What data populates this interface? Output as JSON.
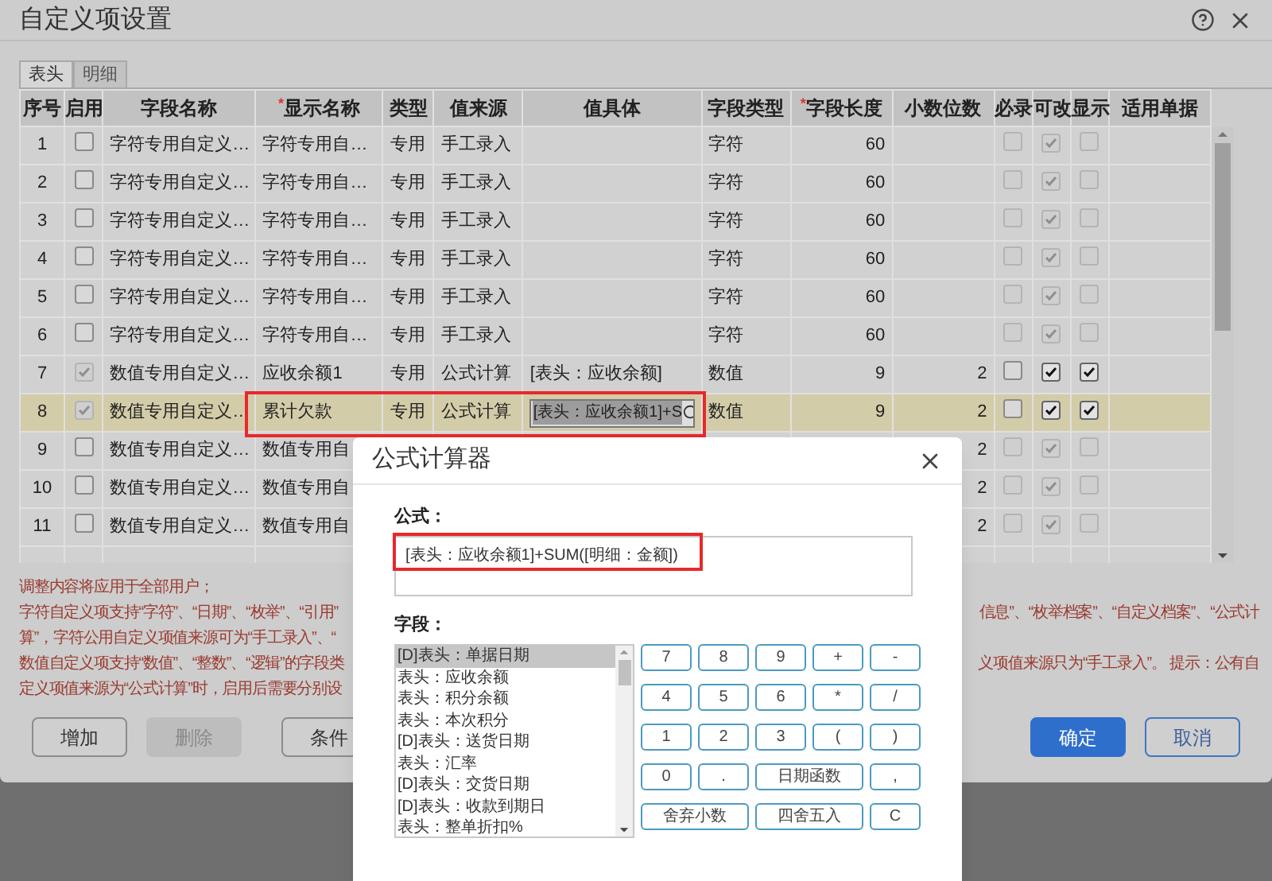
{
  "window": {
    "title": "自定义项设置"
  },
  "tabs": [
    {
      "label": "表头",
      "selected": true
    },
    {
      "label": "明细",
      "selected": false
    }
  ],
  "table": {
    "columns": [
      {
        "label": "序号",
        "required": false
      },
      {
        "label": "启用",
        "required": false
      },
      {
        "label": "字段名称",
        "required": false
      },
      {
        "label": "显示名称",
        "required": true
      },
      {
        "label": "类型",
        "required": false
      },
      {
        "label": "值来源",
        "required": false
      },
      {
        "label": "值具体",
        "required": false
      },
      {
        "label": "字段类型",
        "required": false
      },
      {
        "label": "字段长度",
        "required": true
      },
      {
        "label": "小数位数",
        "required": false
      },
      {
        "label": "必录",
        "required": false
      },
      {
        "label": "可改",
        "required": false
      },
      {
        "label": "显示",
        "required": false
      },
      {
        "label": "适用单据",
        "required": false
      }
    ],
    "rows": [
      {
        "seq": "1",
        "enabled": {
          "checked": false,
          "disabled": false
        },
        "name": "字符专用自定义…",
        "display": "字符专用自…",
        "type": "专用",
        "source": "手工录入",
        "field_type": "字符",
        "length": "60",
        "required": {
          "checked": false,
          "disabled": true
        },
        "editable": {
          "checked": true,
          "disabled": true
        },
        "shown": {
          "checked": false,
          "disabled": true
        },
        "selected": false,
        "marked": false
      },
      {
        "seq": "2",
        "enabled": {
          "checked": false,
          "disabled": false
        },
        "name": "字符专用自定义…",
        "display": "字符专用自…",
        "type": "专用",
        "source": "手工录入",
        "field_type": "字符",
        "length": "60",
        "required": {
          "checked": false,
          "disabled": true
        },
        "editable": {
          "checked": true,
          "disabled": true
        },
        "shown": {
          "checked": false,
          "disabled": true
        },
        "selected": false,
        "marked": false
      },
      {
        "seq": "3",
        "enabled": {
          "checked": false,
          "disabled": false
        },
        "name": "字符专用自定义…",
        "display": "字符专用自…",
        "type": "专用",
        "source": "手工录入",
        "field_type": "字符",
        "length": "60",
        "required": {
          "checked": false,
          "disabled": true
        },
        "editable": {
          "checked": true,
          "disabled": true
        },
        "shown": {
          "checked": false,
          "disabled": true
        },
        "selected": false,
        "marked": false
      },
      {
        "seq": "4",
        "enabled": {
          "checked": false,
          "disabled": false
        },
        "name": "字符专用自定义…",
        "display": "字符专用自…",
        "type": "专用",
        "source": "手工录入",
        "field_type": "字符",
        "length": "60",
        "required": {
          "checked": false,
          "disabled": true
        },
        "editable": {
          "checked": true,
          "disabled": true
        },
        "shown": {
          "checked": false,
          "disabled": true
        },
        "selected": false,
        "marked": false
      },
      {
        "seq": "5",
        "enabled": {
          "checked": false,
          "disabled": false
        },
        "name": "字符专用自定义…",
        "display": "字符专用自…",
        "type": "专用",
        "source": "手工录入",
        "field_type": "字符",
        "length": "60",
        "required": {
          "checked": false,
          "disabled": true
        },
        "editable": {
          "checked": true,
          "disabled": true
        },
        "shown": {
          "checked": false,
          "disabled": true
        },
        "selected": false,
        "marked": false
      },
      {
        "seq": "6",
        "enabled": {
          "checked": false,
          "disabled": false
        },
        "name": "字符专用自定义…",
        "display": "字符专用自…",
        "type": "专用",
        "source": "手工录入",
        "field_type": "字符",
        "length": "60",
        "required": {
          "checked": false,
          "disabled": true
        },
        "editable": {
          "checked": true,
          "disabled": true
        },
        "shown": {
          "checked": false,
          "disabled": true
        },
        "selected": false,
        "marked": false
      },
      {
        "seq": "7",
        "enabled": {
          "checked": true,
          "disabled": true
        },
        "name": "数值专用自定义…",
        "display": "应收余额1",
        "type": "专用",
        "source": "公式计算",
        "value": "[表头：应收余额]",
        "field_type": "数值",
        "length": "9",
        "decimals": "2",
        "required": {
          "checked": false,
          "disabled": false
        },
        "editable": {
          "checked": true,
          "disabled": false
        },
        "shown": {
          "checked": true,
          "disabled": false
        },
        "selected": false,
        "marked": false
      },
      {
        "seq": "8",
        "enabled": {
          "checked": true,
          "disabled": true
        },
        "name": "数值专用自定义…",
        "display": "累计欠款",
        "type": "专用",
        "source": "公式计算",
        "value_input": "[表头：应收余额1]+S",
        "field_type": "数值",
        "length": "9",
        "decimals": "2",
        "required": {
          "checked": false,
          "disabled": false
        },
        "editable": {
          "checked": true,
          "disabled": false
        },
        "shown": {
          "checked": true,
          "disabled": false
        },
        "selected": true,
        "marked": true
      },
      {
        "seq": "9",
        "enabled": {
          "checked": false,
          "disabled": false
        },
        "name": "数值专用自定义…",
        "display": "数值专用自",
        "decimals": "2",
        "required": {
          "checked": false,
          "disabled": true
        },
        "editable": {
          "checked": true,
          "disabled": true
        },
        "shown": {
          "checked": false,
          "disabled": true
        },
        "selected": false,
        "marked": false
      },
      {
        "seq": "10",
        "enabled": {
          "checked": false,
          "disabled": false
        },
        "name": "数值专用自定义…",
        "display": "数值专用自",
        "decimals": "2",
        "required": {
          "checked": false,
          "disabled": true
        },
        "editable": {
          "checked": true,
          "disabled": true
        },
        "shown": {
          "checked": false,
          "disabled": true
        },
        "selected": false,
        "marked": false
      },
      {
        "seq": "11",
        "enabled": {
          "checked": false,
          "disabled": false
        },
        "name": "数值专用自定义…",
        "display": "数值专用自",
        "decimals": "2",
        "required": {
          "checked": false,
          "disabled": true
        },
        "editable": {
          "checked": true,
          "disabled": true
        },
        "shown": {
          "checked": false,
          "disabled": true
        },
        "selected": false,
        "marked": false
      }
    ]
  },
  "notes": [
    {
      "left": "调整内容将应用于全部用户；"
    },
    {
      "left": "字符自定义项支持“字符”、“日期”、“枚举”、“引用”",
      "right": "信息”、“枚举档案”、“自定义档案”、“公式计"
    },
    {
      "left": "算”，字符公用自定义项值来源可为“手工录入”、“"
    },
    {
      "left": "数值自定义项支持“数值”、“整数”、“逻辑”的字段类",
      "right": "义项值来源只为“手工录入”。 提示：公有自"
    },
    {
      "left": "定义项值来源为“公式计算”时，启用后需要分别设"
    }
  ],
  "buttons": [
    {
      "label": "增加",
      "kind": "normal"
    },
    {
      "label": "删除",
      "kind": "disabled"
    },
    {
      "label": "条件",
      "kind": "normal"
    },
    {
      "label": "确定",
      "kind": "primary"
    },
    {
      "label": "取消",
      "kind": "secondary"
    }
  ],
  "calculator": {
    "title": "公式计算器",
    "formula_label": "公式：",
    "formula": "[表头：应收余额1]+SUM([明细：金额])",
    "formula_marked": true,
    "fields_label": "字段：",
    "fields": [
      {
        "label": "[D]表头：单据日期",
        "selected": true
      },
      {
        "label": "表头：应收余额",
        "selected": false
      },
      {
        "label": "表头：积分余额",
        "selected": false
      },
      {
        "label": "表头：本次积分",
        "selected": false
      },
      {
        "label": "[D]表头：送货日期",
        "selected": false
      },
      {
        "label": "表头：汇率",
        "selected": false
      },
      {
        "label": "[D]表头：交货日期",
        "selected": false
      },
      {
        "label": "[D]表头：收款到期日",
        "selected": false
      },
      {
        "label": "表头：整单折扣%",
        "selected": false
      }
    ],
    "keys": [
      {
        "label": "7",
        "kind": "single"
      },
      {
        "label": "8",
        "kind": "single"
      },
      {
        "label": "9",
        "kind": "single"
      },
      {
        "label": "+",
        "kind": "single"
      },
      {
        "label": "-",
        "kind": "single"
      },
      {
        "label": "4",
        "kind": "single"
      },
      {
        "label": "5",
        "kind": "single"
      },
      {
        "label": "6",
        "kind": "single"
      },
      {
        "label": "*",
        "kind": "single"
      },
      {
        "label": "/",
        "kind": "single"
      },
      {
        "label": "1",
        "kind": "single"
      },
      {
        "label": "2",
        "kind": "single"
      },
      {
        "label": "3",
        "kind": "single"
      },
      {
        "label": "(",
        "kind": "single"
      },
      {
        "label": ")",
        "kind": "single"
      },
      {
        "label": "0",
        "kind": "single"
      },
      {
        "label": ".",
        "kind": "single"
      },
      {
        "label": "日期函数",
        "kind": "wide"
      },
      {
        "label": ",",
        "kind": "single"
      },
      {
        "label": "舍弃小数",
        "kind": "wide"
      },
      {
        "label": "四舍五入",
        "kind": "wide"
      },
      {
        "label": "C",
        "kind": "single"
      }
    ]
  }
}
